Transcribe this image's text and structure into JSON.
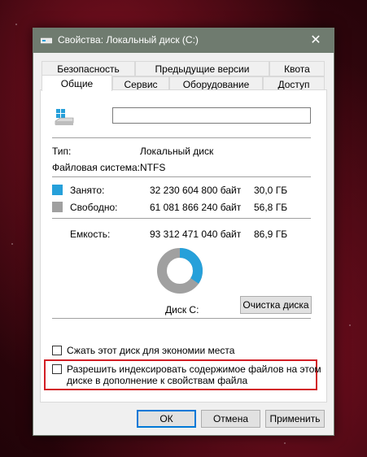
{
  "window": {
    "title": "Свойства: Локальный диск (C:)",
    "close_glyph": "✕"
  },
  "tabs_top": [
    "Безопасность",
    "Предыдущие версии",
    "Квота"
  ],
  "tabs_bottom": [
    "Общие",
    "Сервис",
    "Оборудование",
    "Доступ"
  ],
  "selected_tab": "Общие",
  "general": {
    "name_value": "",
    "type_label": "Тип:",
    "type_value": "Локальный диск",
    "fs_label": "Файловая система:",
    "fs_value": "NTFS",
    "used_label": "Занято:",
    "used_bytes": "32 230 604 800 байт",
    "used_gb": "30,0 ГБ",
    "free_label": "Свободно:",
    "free_bytes": "61 081 866 240 байт",
    "free_gb": "56,8 ГБ",
    "capacity_label": "Емкость:",
    "capacity_bytes": "93 312 471 040 байт",
    "capacity_gb": "86,9 ГБ",
    "disk_label": "Диск C:",
    "cleanup_button": "Очистка диска",
    "used_fraction": 0.345,
    "used_color": "#26a0da",
    "free_color": "#a0a0a0"
  },
  "options": {
    "compress_label": "Сжать этот диск для экономии места",
    "compress_checked": false,
    "index_label_line1": "Разрешить индексировать содержимое файлов на этом",
    "index_label_line2": "диске в дополнение к свойствам файла",
    "index_checked": false
  },
  "buttons": {
    "ok": "ОК",
    "cancel": "Отмена",
    "apply": "Применить"
  }
}
